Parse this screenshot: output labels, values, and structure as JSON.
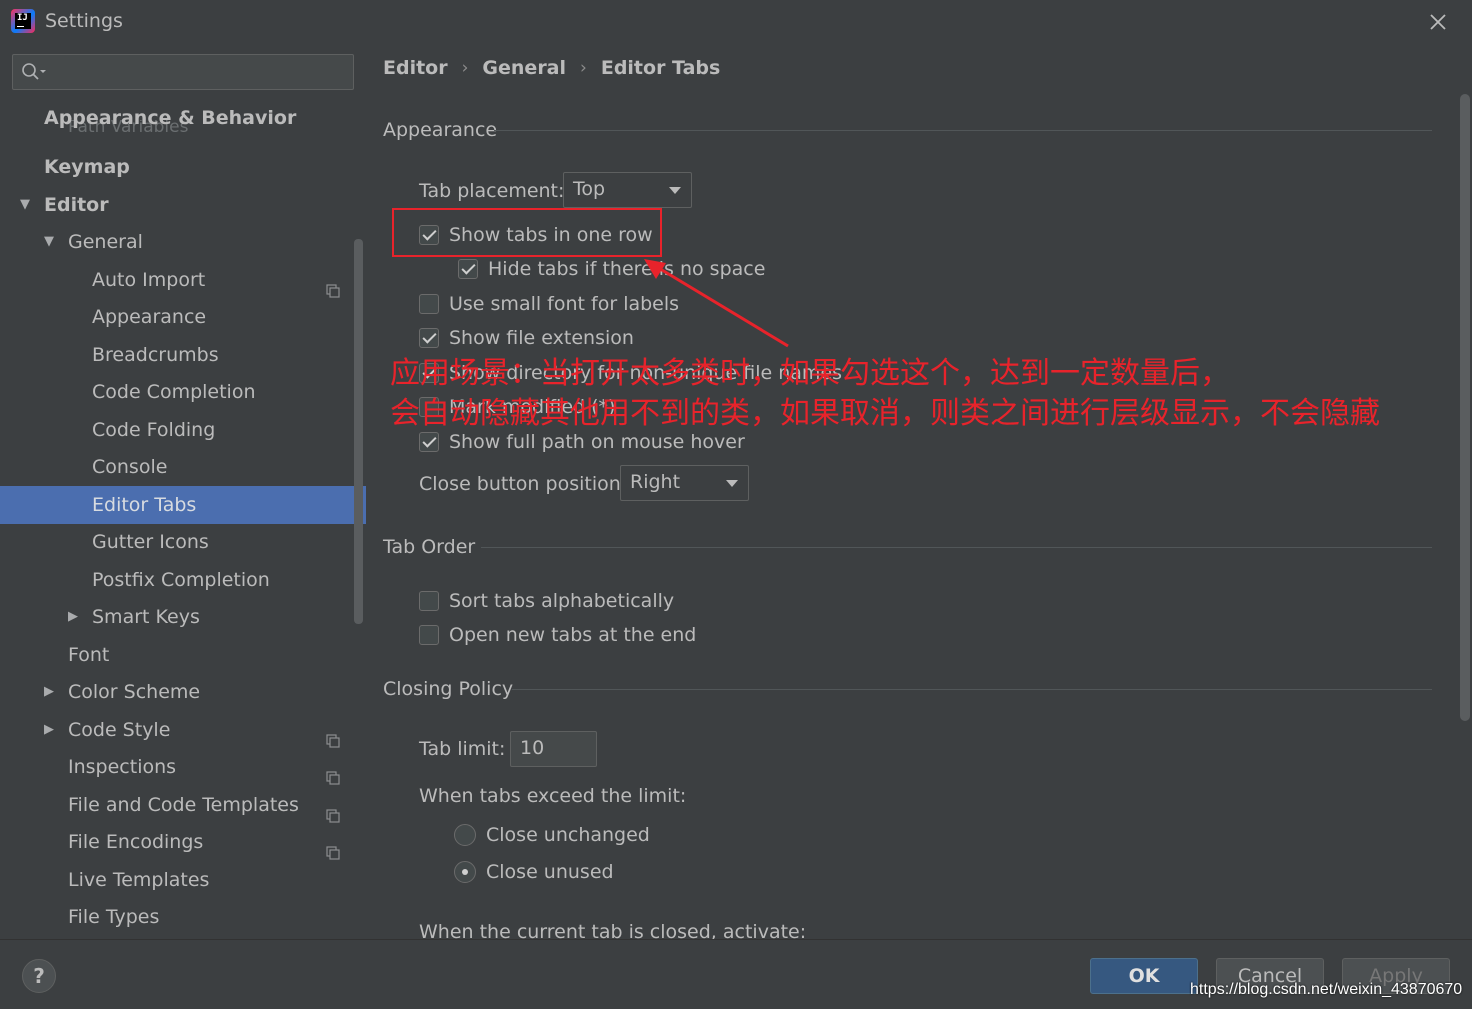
{
  "window": {
    "title": "Settings",
    "logo_text": "IJ"
  },
  "sidebar": {
    "search_placeholder": "",
    "ghost_text": "Path Variables",
    "items": [
      {
        "label": "Appearance & Behavior",
        "level": 0,
        "bold": true
      },
      {
        "label": "Keymap",
        "level": 0,
        "bold": true
      },
      {
        "label": "Editor",
        "level": 0,
        "bold": true,
        "expanded": true
      },
      {
        "label": "General",
        "level": 1,
        "expanded": true
      },
      {
        "label": "Auto Import",
        "level": 2,
        "project_icon": true
      },
      {
        "label": "Appearance",
        "level": 2
      },
      {
        "label": "Breadcrumbs",
        "level": 2
      },
      {
        "label": "Code Completion",
        "level": 2
      },
      {
        "label": "Code Folding",
        "level": 2
      },
      {
        "label": "Console",
        "level": 2
      },
      {
        "label": "Editor Tabs",
        "level": 2,
        "selected": true
      },
      {
        "label": "Gutter Icons",
        "level": 2
      },
      {
        "label": "Postfix Completion",
        "level": 2
      },
      {
        "label": "Smart Keys",
        "level": 2,
        "collapsed": true
      },
      {
        "label": "Font",
        "level": 1
      },
      {
        "label": "Color Scheme",
        "level": 1,
        "collapsed": true
      },
      {
        "label": "Code Style",
        "level": 1,
        "collapsed": true,
        "project_icon": true
      },
      {
        "label": "Inspections",
        "level": 1,
        "project_icon": true
      },
      {
        "label": "File and Code Templates",
        "level": 1,
        "project_icon": true
      },
      {
        "label": "File Encodings",
        "level": 1,
        "project_icon": true
      },
      {
        "label": "Live Templates",
        "level": 1
      },
      {
        "label": "File Types",
        "level": 1
      }
    ]
  },
  "breadcrumb": [
    "Editor",
    "General",
    "Editor Tabs"
  ],
  "appearance": {
    "title": "Appearance",
    "tab_placement_label": "Tab placement:",
    "tab_placement_value": "Top",
    "show_one_row": "Show tabs in one row",
    "hide_no_space": "Hide tabs if there is no space",
    "small_font": "Use small font for labels",
    "file_ext": "Show file extension",
    "show_dir": "Show directory for non-unique file names",
    "mark_modified": "Mark modified (*)",
    "full_path": "Show full path on mouse hover",
    "close_btn_label": "Close button position:",
    "close_btn_value": "Right"
  },
  "tab_order": {
    "title": "Tab Order",
    "sort_alpha": "Sort tabs alphabetically",
    "open_end": "Open new tabs at the end"
  },
  "closing_policy": {
    "title": "Closing Policy",
    "tab_limit_label": "Tab limit:",
    "tab_limit_value": "10",
    "exceed_label": "When tabs exceed the limit:",
    "close_unchanged": "Close unchanged",
    "close_unused": "Close unused",
    "current_closed_label": "When the current tab is closed, activate:"
  },
  "annotation": {
    "line1": "应用场景：当打开太多类时，如果勾选这个，达到一定数量后，",
    "line2": "会自动隐藏其他用不到的类，如果取消，则类之间进行层级显示，不会隐藏",
    "color": "#e8232b"
  },
  "buttons": {
    "help": "?",
    "ok": "OK",
    "cancel": "Cancel",
    "apply": "Apply"
  },
  "watermark": "https://blog.csdn.net/weixin_43870670",
  "colors": {
    "background": "#3c3f41",
    "selection": "#4b6eaf",
    "ok_button": "#365880"
  }
}
